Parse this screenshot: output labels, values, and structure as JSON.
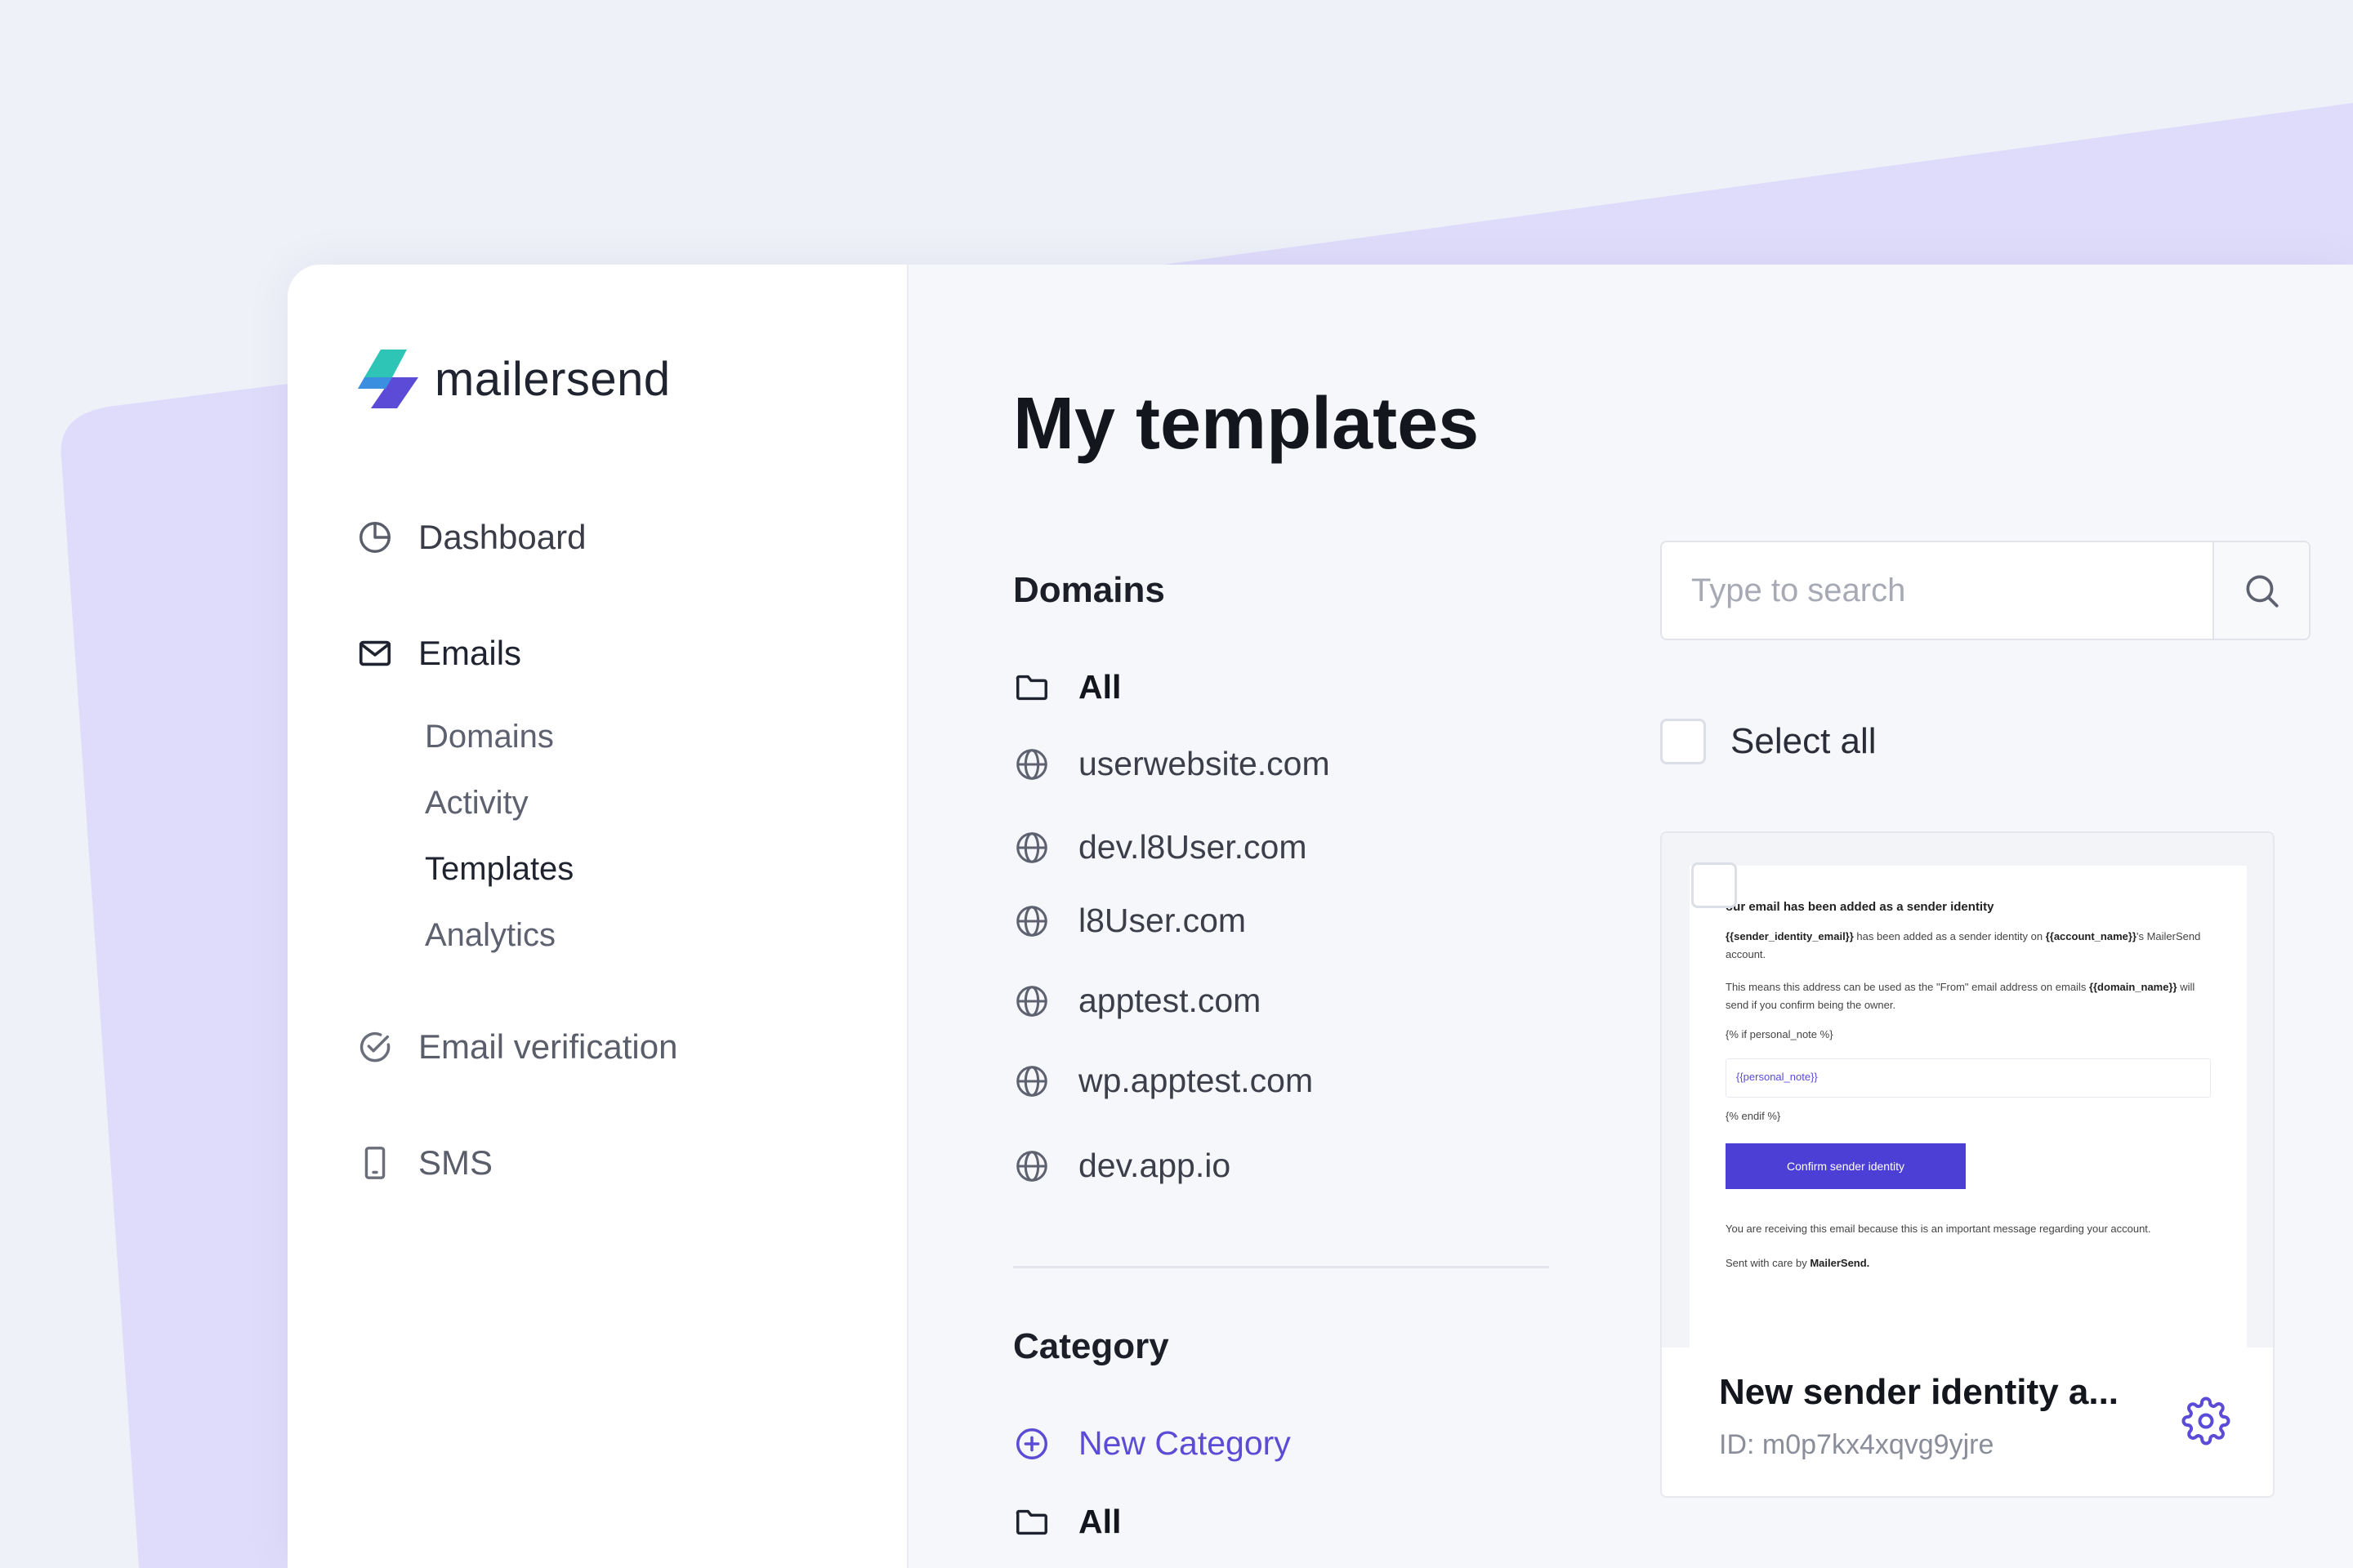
{
  "brand": {
    "name": "mailersend"
  },
  "sidebar": {
    "items": [
      {
        "label": "Dashboard",
        "icon": "pie-chart-icon"
      },
      {
        "label": "Emails",
        "icon": "envelope-icon"
      },
      {
        "label": "Email verification",
        "icon": "check-circle-icon"
      },
      {
        "label": "SMS",
        "icon": "phone-icon"
      }
    ],
    "email_subitems": [
      {
        "label": "Domains"
      },
      {
        "label": "Activity"
      },
      {
        "label": "Templates",
        "active": true
      },
      {
        "label": "Analytics"
      }
    ]
  },
  "main": {
    "title": "My templates",
    "domains": {
      "title": "Domains",
      "items": [
        {
          "label": "All",
          "icon": "folder-icon"
        },
        {
          "label": "userwebsite.com",
          "icon": "globe-icon"
        },
        {
          "label": "dev.l8User.com",
          "icon": "globe-icon"
        },
        {
          "label": "l8User.com",
          "icon": "globe-icon"
        },
        {
          "label": "apptest.com",
          "icon": "globe-icon"
        },
        {
          "label": "wp.apptest.com",
          "icon": "globe-icon"
        },
        {
          "label": "dev.app.io",
          "icon": "globe-icon"
        }
      ]
    },
    "category": {
      "title": "Category",
      "new_label": "New Category",
      "all_label": "All"
    },
    "search": {
      "placeholder": "Type to search",
      "value": ""
    },
    "select_all_label": "Select all",
    "template_card": {
      "name": "New sender identity a...",
      "id": "ID: m0p7kx4xqvg9yjre",
      "preview": {
        "heading": "our email has been added as a sender identity",
        "p1_var1": "{{sender_identity_email}}",
        "p1_mid": " has been added as a sender identity on ",
        "p1_var2": "{{account_name}}",
        "p1_end": "'s MailerSend account.",
        "p2_start": "This means this address can be used as the \"From\" email address on emails ",
        "p2_var": "{{domain_name}}",
        "p2_end": " will send if you confirm being the owner.",
        "if_tag": "{% if personal_note %}",
        "note_var": "{{personal_note}}",
        "endif_tag": "{% endif %}",
        "button": "Confirm sender identity",
        "footer1": "You are receiving this email because this is an important message regarding your account.",
        "footer2_start": "Sent with care by ",
        "footer2_brand": "MailerSend."
      }
    }
  },
  "colors": {
    "accent": "#5b4bd6",
    "background": "#eef1f8",
    "decor": "#dedbfb"
  }
}
